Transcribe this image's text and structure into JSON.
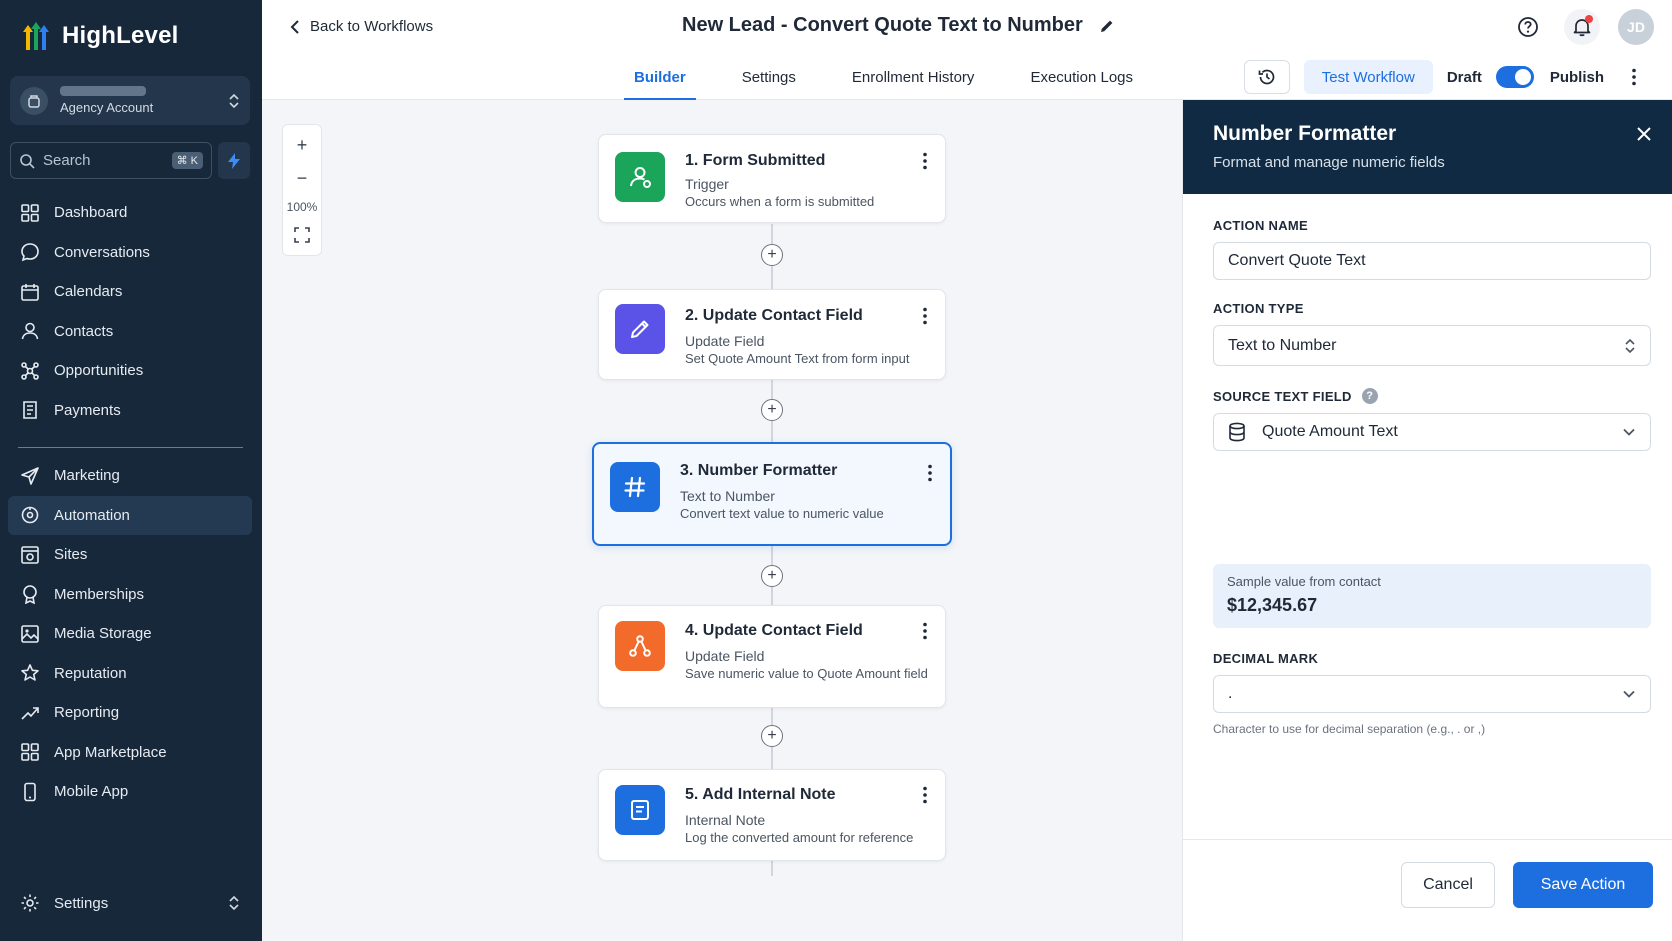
{
  "brand": {
    "name": "HighLevel"
  },
  "account": {
    "type_label": "Agency Account"
  },
  "search": {
    "label": "Search",
    "shortcut": "⌘ K"
  },
  "sidebar": {
    "items": [
      {
        "label": "Dashboard",
        "icon": "dashboard-icon"
      },
      {
        "label": "Conversations",
        "icon": "chat-icon"
      },
      {
        "label": "Calendars",
        "icon": "calendar-icon"
      },
      {
        "label": "Contacts",
        "icon": "user-icon"
      },
      {
        "label": "Opportunities",
        "icon": "opportunities-icon"
      },
      {
        "label": "Payments",
        "icon": "receipt-icon"
      }
    ],
    "items2": [
      {
        "label": "Marketing",
        "icon": "send-icon"
      },
      {
        "label": "Automation",
        "icon": "automation-icon",
        "active": true
      },
      {
        "label": "Sites",
        "icon": "sites-icon"
      },
      {
        "label": "Memberships",
        "icon": "badge-icon"
      },
      {
        "label": "Media Storage",
        "icon": "image-icon"
      },
      {
        "label": "Reputation",
        "icon": "star-icon"
      },
      {
        "label": "Reporting",
        "icon": "trend-icon"
      },
      {
        "label": "App Marketplace",
        "icon": "apps-icon"
      },
      {
        "label": "Mobile App",
        "icon": "phone-icon"
      }
    ],
    "settings_label": "Settings"
  },
  "header": {
    "back_label": "Back to Workflows",
    "title": "New Lead - Convert Quote Text to Number",
    "user_initials": "JD",
    "tabs": [
      "Builder",
      "Settings",
      "Enrollment History",
      "Execution Logs"
    ],
    "test_label": "Test Workflow",
    "draft_label": "Draft",
    "publish_label": "Publish"
  },
  "canvas": {
    "zoom": "100%"
  },
  "steps": [
    {
      "title": "1. Form Submitted",
      "subtitle": "Trigger",
      "desc": "Occurs when a form is submitted",
      "color": "#1aa55a"
    },
    {
      "title": "2. Update Contact Field",
      "subtitle": "Update Field",
      "desc": "Set Quote Amount Text from form input",
      "color": "#5b52e8"
    },
    {
      "title": "3. Number Formatter",
      "subtitle": "Text to Number",
      "desc": "Convert text value to numeric value",
      "color": "#1d6fe0"
    },
    {
      "title": "4. Update Contact Field",
      "subtitle": "Update Field",
      "desc": "Save numeric value to Quote Amount field",
      "color": "#f26b2a"
    },
    {
      "title": "5. Add Internal Note",
      "subtitle": "Internal Note",
      "desc": "Log the converted amount for reference",
      "color": "#1d6fe0"
    }
  ],
  "panel": {
    "title": "Number Formatter",
    "subtitle": "Format and manage numeric fields",
    "action_name_label": "ACTION NAME",
    "action_name_value": "Convert Quote Text",
    "action_type_label": "ACTION TYPE",
    "action_type_value": "Text to Number",
    "source_label": "SOURCE TEXT FIELD",
    "source_value": "Quote Amount Text",
    "sample_label": "Sample value from contact",
    "sample_value": "$12,345.67",
    "decimal_label": "DECIMAL MARK",
    "decimal_value": ".",
    "decimal_hint": "Character to use for decimal separation (e.g., . or ,)",
    "cancel_label": "Cancel",
    "save_label": "Save Action"
  }
}
